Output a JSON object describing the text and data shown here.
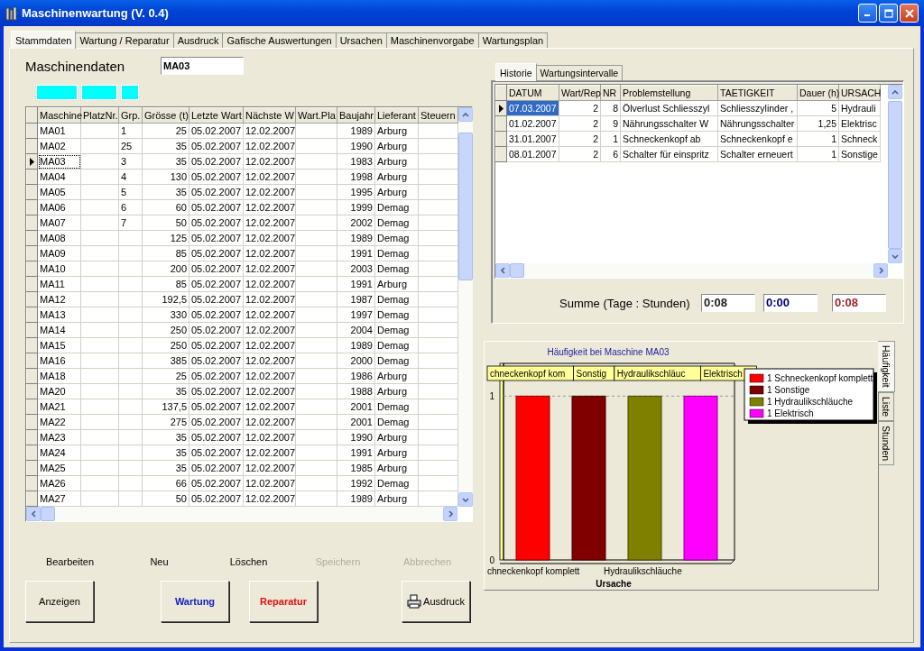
{
  "window": {
    "title": "Maschinenwartung (V. 0.4)"
  },
  "tabs": [
    {
      "label": "Stammdaten",
      "selected": true
    },
    {
      "label": "Wartung / Reparatur",
      "selected": false
    },
    {
      "label": "Ausdruck",
      "selected": false
    },
    {
      "label": "Gafische Auswertungen",
      "selected": false
    },
    {
      "label": "Ursachen",
      "selected": false
    },
    {
      "label": "Maschinenvorgabe",
      "selected": false
    },
    {
      "label": "Wartungsplan",
      "selected": false
    }
  ],
  "machine_data": {
    "label": "Maschinendaten",
    "value": "MA03"
  },
  "machines": {
    "columns": [
      "Maschine",
      "PlatzNr.",
      "Grp.",
      "Grösse (t)",
      "Letzte Wart",
      "Nächste W",
      "Wart.Pla",
      "Baujahr",
      "Lieferant",
      "Steuern"
    ],
    "rows": [
      {
        "cells": [
          "MA01",
          null,
          "1",
          "25",
          "05.02.2007",
          "12.02.2007",
          null,
          "1989",
          "Arburg",
          null
        ],
        "selected": false
      },
      {
        "cells": [
          "MA02",
          null,
          "25",
          "35",
          "05.02.2007",
          "12.02.2007",
          null,
          "1990",
          "Arburg",
          null
        ],
        "selected": false
      },
      {
        "cells": [
          "MA03",
          null,
          "3",
          "35",
          "05.02.2007",
          "12.02.2007",
          null,
          "1983",
          "Arburg",
          null
        ],
        "selected": true
      },
      {
        "cells": [
          "MA04",
          null,
          "4",
          "130",
          "05.02.2007",
          "12.02.2007",
          null,
          "1998",
          "Arburg",
          null
        ],
        "selected": false
      },
      {
        "cells": [
          "MA05",
          null,
          "5",
          "35",
          "05.02.2007",
          "12.02.2007",
          null,
          "1995",
          "Arburg",
          null
        ],
        "selected": false
      },
      {
        "cells": [
          "MA06",
          null,
          "6",
          "60",
          "05.02.2007",
          "12.02.2007",
          null,
          "1999",
          "Demag",
          null
        ],
        "selected": false
      },
      {
        "cells": [
          "MA07",
          null,
          "7",
          "50",
          "05.02.2007",
          "12.02.2007",
          null,
          "2002",
          "Demag",
          null
        ],
        "selected": false
      },
      {
        "cells": [
          "MA08",
          null,
          null,
          "125",
          "05.02.2007",
          "12.02.2007",
          null,
          "1989",
          "Demag",
          null
        ],
        "selected": false
      },
      {
        "cells": [
          "MA09",
          null,
          null,
          "85",
          "05.02.2007",
          "12.02.2007",
          null,
          "1991",
          "Demag",
          null
        ],
        "selected": false
      },
      {
        "cells": [
          "MA10",
          null,
          null,
          "200",
          "05.02.2007",
          "12.02.2007",
          null,
          "2003",
          "Demag",
          null
        ],
        "selected": false
      },
      {
        "cells": [
          "MA11",
          null,
          null,
          "85",
          "05.02.2007",
          "12.02.2007",
          null,
          "1991",
          "Arburg",
          null
        ],
        "selected": false
      },
      {
        "cells": [
          "MA12",
          null,
          null,
          "192,5",
          "05.02.2007",
          "12.02.2007",
          null,
          "1987",
          "Demag",
          null
        ],
        "selected": false
      },
      {
        "cells": [
          "MA13",
          null,
          null,
          "330",
          "05.02.2007",
          "12.02.2007",
          null,
          "1997",
          "Demag",
          null
        ],
        "selected": false
      },
      {
        "cells": [
          "MA14",
          null,
          null,
          "250",
          "05.02.2007",
          "12.02.2007",
          null,
          "2004",
          "Demag",
          null
        ],
        "selected": false
      },
      {
        "cells": [
          "MA15",
          null,
          null,
          "250",
          "05.02.2007",
          "12.02.2007",
          null,
          "1989",
          "Demag",
          null
        ],
        "selected": false
      },
      {
        "cells": [
          "MA16",
          null,
          null,
          "385",
          "05.02.2007",
          "12.02.2007",
          null,
          "2000",
          "Demag",
          null
        ],
        "selected": false
      },
      {
        "cells": [
          "MA18",
          null,
          null,
          "25",
          "05.02.2007",
          "12.02.2007",
          null,
          "1986",
          "Arburg",
          null
        ],
        "selected": false
      },
      {
        "cells": [
          "MA20",
          null,
          null,
          "35",
          "05.02.2007",
          "12.02.2007",
          null,
          "1988",
          "Arburg",
          null
        ],
        "selected": false
      },
      {
        "cells": [
          "MA21",
          null,
          null,
          "137,5",
          "05.02.2007",
          "12.02.2007",
          null,
          "2001",
          "Demag",
          null
        ],
        "selected": false
      },
      {
        "cells": [
          "MA22",
          null,
          null,
          "275",
          "05.02.2007",
          "12.02.2007",
          null,
          "2001",
          "Demag",
          null
        ],
        "selected": false
      },
      {
        "cells": [
          "MA23",
          null,
          null,
          "35",
          "05.02.2007",
          "12.02.2007",
          null,
          "1990",
          "Arburg",
          null
        ],
        "selected": false
      },
      {
        "cells": [
          "MA24",
          null,
          null,
          "35",
          "05.02.2007",
          "12.02.2007",
          null,
          "1991",
          "Arburg",
          null
        ],
        "selected": false
      },
      {
        "cells": [
          "MA25",
          null,
          null,
          "35",
          "05.02.2007",
          "12.02.2007",
          null,
          "1985",
          "Arburg",
          null
        ],
        "selected": false
      },
      {
        "cells": [
          "MA26",
          null,
          null,
          "66",
          "05.02.2007",
          "12.02.2007",
          null,
          "1992",
          "Demag",
          null
        ],
        "selected": false
      },
      {
        "cells": [
          "MA27",
          null,
          null,
          "50",
          "05.02.2007",
          "12.02.2007",
          null,
          "1989",
          "Arburg",
          null
        ],
        "selected": false
      }
    ]
  },
  "actions": [
    {
      "label": "Bearbeiten",
      "disabled": false
    },
    {
      "label": "Neu",
      "disabled": false
    },
    {
      "label": "Löschen",
      "disabled": false
    },
    {
      "label": "Speichern",
      "disabled": true
    },
    {
      "label": "Abbrechen",
      "disabled": true
    }
  ],
  "buttons": [
    {
      "label": "Anzeigen",
      "kind": "plain"
    },
    {
      "label": "Wartung",
      "kind": "maintenance"
    },
    {
      "label": "Reparatur",
      "kind": "repair"
    },
    {
      "label": "Ausdruck",
      "kind": "print"
    }
  ],
  "history": {
    "tabs": [
      {
        "label": "Historie",
        "selected": true
      },
      {
        "label": "Wartungsintervalle",
        "selected": false
      }
    ],
    "columns": [
      "DATUM",
      "Wart/Rep",
      "NR",
      "Problemstellung",
      "TAETIGKEIT",
      "Dauer (h)",
      "URSACH"
    ],
    "rows": [
      {
        "cells": [
          "07.03.2007",
          "2",
          "8",
          "Ölverlust Schliesszyl",
          "Schliesszylinder ,",
          "5",
          "Hydrauli"
        ],
        "selected": true
      },
      {
        "cells": [
          "01.02.2007",
          "2",
          "9",
          "Nährungsschalter W",
          "Nährungsschalter",
          "1,25",
          "Elektrisc"
        ],
        "selected": false
      },
      {
        "cells": [
          "31.01.2007",
          "2",
          "1",
          "Schneckenkopf ab",
          "Schneckenkopf e",
          "1",
          "Schneck"
        ],
        "selected": false
      },
      {
        "cells": [
          "08.01.2007",
          "2",
          "6",
          "Schalter für einspritz",
          "Schalter erneuert",
          "1",
          "Sonstige"
        ],
        "selected": false
      }
    ],
    "sum": {
      "label": "Summe (Tage : Stunden)",
      "fields": [
        {
          "value": "0:08",
          "color": "#202020"
        },
        {
          "value": "0:00",
          "color": "#000080"
        },
        {
          "value": "0:08",
          "color": "#a0262c"
        }
      ]
    }
  },
  "chart": {
    "tabs": [
      {
        "label": "Häufigkeit",
        "selected": true
      },
      {
        "label": "Liste",
        "selected": false
      },
      {
        "label": "Stunden",
        "selected": false
      }
    ],
    "chart_data": {
      "type": "bar",
      "title": "Häufigkeit bei Maschine MA03",
      "xlabel": "Ursache",
      "categories": [
        "chneckenkopf komplett",
        null,
        "Hydraulikschläuche",
        null
      ],
      "ylim": [
        0,
        1.2
      ],
      "yticks": [
        0,
        1
      ],
      "legend": "upper right",
      "value_labels": [
        "chneckenkopf kom",
        "Sonstig",
        "Hydraulikschläuc",
        "Elektrisch"
      ],
      "series": [
        {
          "name": "1 Schneckenkopf komplett",
          "color": "#ff0000",
          "values": [
            1,
            null,
            null,
            null
          ]
        },
        {
          "name": "1 Sonstige",
          "color": "#800000",
          "values": [
            null,
            1,
            null,
            null
          ]
        },
        {
          "name": "1 Hydraulikschläuche",
          "color": "#808000",
          "values": [
            null,
            null,
            1,
            null
          ]
        },
        {
          "name": "1 Elektrisch",
          "color": "#ff00ff",
          "values": [
            null,
            null,
            null,
            1
          ]
        }
      ]
    }
  }
}
